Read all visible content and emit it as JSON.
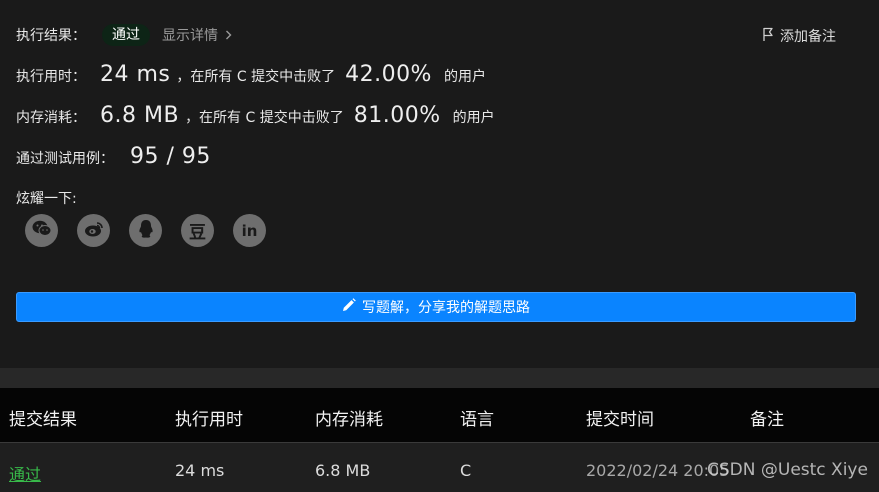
{
  "result": {
    "label": "执行结果：",
    "status": "通过",
    "detail_link": "显示详情",
    "note_button": "添加备注"
  },
  "runtime": {
    "label": "执行用时：",
    "value": "24 ms",
    "prefix": "，在所有 C 提交中击败了",
    "percent": "42.00%",
    "suffix": "的用户"
  },
  "memory": {
    "label": "内存消耗：",
    "value": "6.8 MB",
    "prefix": "，在所有 C 提交中击败了",
    "percent": "81.00%",
    "suffix": "的用户"
  },
  "tests": {
    "label": "通过测试用例：",
    "value": "95 / 95"
  },
  "share": {
    "label": "炫耀一下:",
    "items": [
      "wechat-icon",
      "weibo-icon",
      "qq-icon",
      "douban-icon",
      "linkedin-icon"
    ],
    "douban_glyph": "豆",
    "linkedin_glyph": "in"
  },
  "write_solution": {
    "label": "写题解，分享我的解题思路"
  },
  "table": {
    "headers": [
      "提交结果",
      "执行用时",
      "内存消耗",
      "语言",
      "提交时间",
      "备注"
    ],
    "rows": [
      [
        "通过",
        "24 ms",
        "6.8 MB",
        "C",
        "2022/02/24 20:05",
        ""
      ]
    ]
  },
  "watermark": "CSDN @Uestc Xiye",
  "colors": {
    "accent": "#0a84ff",
    "pass_green": "#38b94a",
    "badge_bg": "#0d2416"
  }
}
